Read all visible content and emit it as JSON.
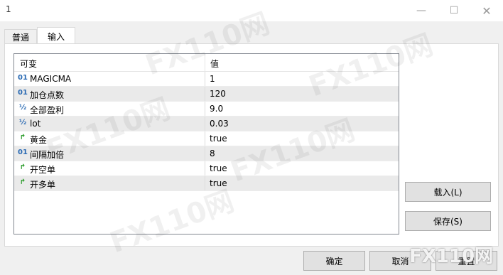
{
  "window": {
    "title": "1"
  },
  "tabs": [
    {
      "label": "普通"
    },
    {
      "label": "输入"
    }
  ],
  "grid": {
    "headers": {
      "variable": "可变",
      "value": "值"
    },
    "rows": [
      {
        "type_icon": "01",
        "name": "MAGICMA",
        "value": "1"
      },
      {
        "type_icon": "01",
        "name": "加仓点数",
        "value": "120"
      },
      {
        "type_icon": "½",
        "name": "全部盈利",
        "value": "9.0"
      },
      {
        "type_icon": "½",
        "name": "lot",
        "value": "0.03"
      },
      {
        "type_icon": "↱",
        "name": "黄金",
        "value": "true"
      },
      {
        "type_icon": "01",
        "name": "间隔加倍",
        "value": "8"
      },
      {
        "type_icon": "↱",
        "name": "开空单",
        "value": "true"
      },
      {
        "type_icon": "↱",
        "name": "开多单",
        "value": "true"
      }
    ]
  },
  "buttons": {
    "load": "载入(L)",
    "save": "保存(S)",
    "ok": "确定",
    "cancel": "取消",
    "reset": "重置"
  },
  "watermark": {
    "text": "FX110网"
  }
}
